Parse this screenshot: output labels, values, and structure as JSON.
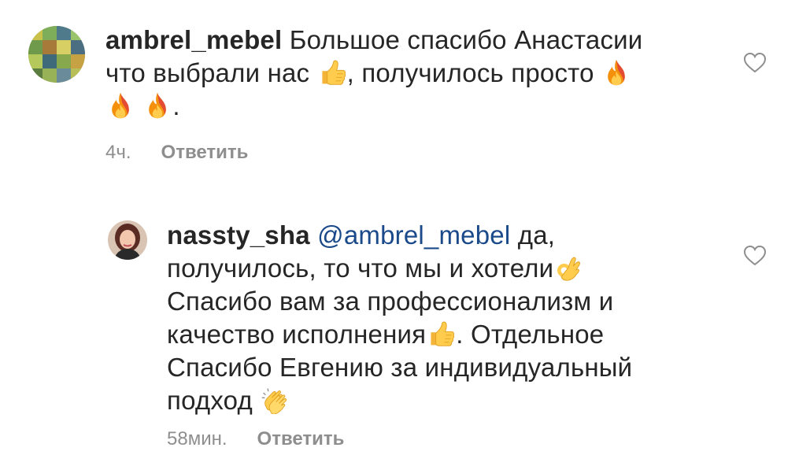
{
  "comments": [
    {
      "username": "ambrel_mebel",
      "line1": "Большое спасибо Анастасии",
      "line2a": "что выбрали нас",
      "line2b": ", получилось просто",
      "line3_end": ".",
      "time": "4ч.",
      "reply_label": "Ответить",
      "emojis": [
        "thumbs-up-icon",
        "fire-icon",
        "fire-icon",
        "fire-icon"
      ]
    },
    {
      "username": "nassty_sha",
      "mention": "@ambrel_mebel",
      "line1_rest": "да,",
      "line2": "получилось, то что мы и хотели",
      "line3": "Спасибо вам за профессионализм и",
      "line4a": "качество исполнения",
      "line4b": ". Отдельное",
      "line5": "Спасибо Евгению за  индивидуальный",
      "line6": "подход",
      "time": "58мин.",
      "reply_label": "Ответить",
      "emojis": [
        "ok-hand-icon",
        "thumbs-up-icon",
        "clapping-hands-icon"
      ]
    }
  ],
  "colors": {
    "text": "#262626",
    "secondary": "#8e8e8e",
    "mention": "#1b4a8a",
    "background": "#ffffff"
  }
}
